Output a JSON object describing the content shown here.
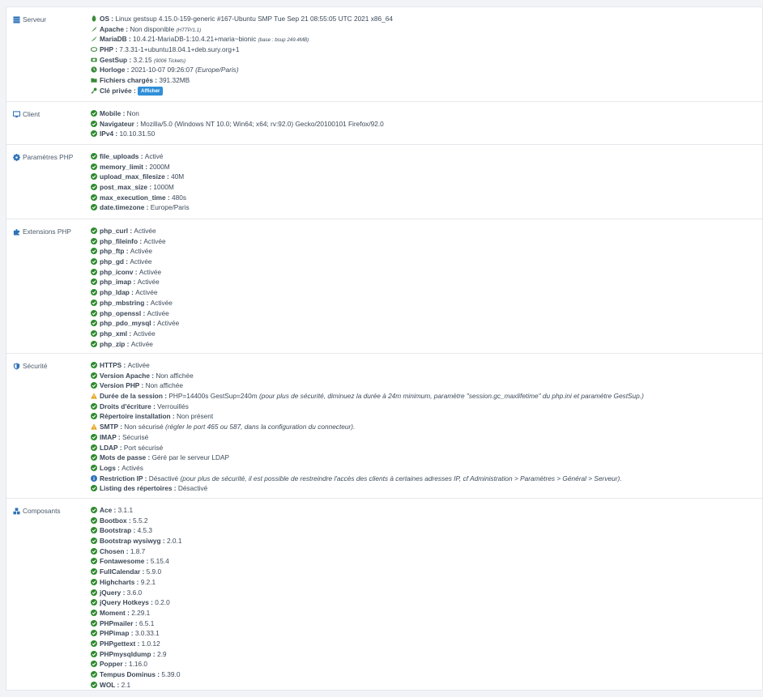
{
  "colors": {
    "ok": "#2e8b2e",
    "warn": "#e7a21b",
    "info": "#2f73b8",
    "icon_green": "#3a8a3a",
    "button": "#2f8fd8"
  },
  "sections": [
    {
      "id": "serveur",
      "label": "Serveur",
      "icon": "server-icon",
      "rows": [
        {
          "icon": "linux-icon",
          "label": "OS",
          "value": "Linux gestsup 4.15.0-159-generic #167-Ubuntu SMP Tue Sep 21 08:55:05 UTC 2021 x86_64",
          "note": ""
        },
        {
          "icon": "feather-icon",
          "label": "Apache",
          "value": "Non disponible",
          "note": "(HTTP/1.1)"
        },
        {
          "icon": "dolphin-icon",
          "label": "MariaDB",
          "value": "10.4.21-MariaDB-1:10.4.21+maria~bionic",
          "note": "(base : bsup 249.4MB)"
        },
        {
          "icon": "php-icon",
          "label": "PHP",
          "value": "7.3.31-1+ubuntu18.04.1+deb.sury.org+1",
          "note": ""
        },
        {
          "icon": "ticket-icon",
          "label": "GestSup",
          "value": "3.2.15",
          "note": "(9006 Tickets)"
        },
        {
          "icon": "clock-icon",
          "label": "Horloge",
          "value": "2021-10-07 09:26:07",
          "note": "(Europe/Paris)"
        },
        {
          "icon": "folder-icon",
          "label": "Fichiers chargés",
          "value": "391.32MB",
          "note": ""
        },
        {
          "icon": "key-icon",
          "label": "Clé privée",
          "value": "",
          "note": "",
          "button": "Afficher"
        }
      ]
    },
    {
      "id": "client",
      "label": "Client",
      "icon": "desktop-icon",
      "rows": [
        {
          "icon": "check-icon",
          "label": "Mobile",
          "value": "Non"
        },
        {
          "icon": "check-icon",
          "label": "Navigateur",
          "value": "Mozilla/5.0 (Windows NT 10.0; Win64; x64; rv:92.0) Gecko/20100101 Firefox/92.0"
        },
        {
          "icon": "check-icon",
          "label": "IPv4",
          "value": "10.10.31.50"
        }
      ]
    },
    {
      "id": "php-params",
      "label": "Paramètres PHP",
      "icon": "gear-icon",
      "rows": [
        {
          "icon": "check-icon",
          "label": "file_uploads",
          "value": "Activé"
        },
        {
          "icon": "check-icon",
          "label": "memory_limit",
          "value": "2000M"
        },
        {
          "icon": "check-icon",
          "label": "upload_max_filesize",
          "value": "40M"
        },
        {
          "icon": "check-icon",
          "label": "post_max_size",
          "value": "1000M"
        },
        {
          "icon": "check-icon",
          "label": "max_execution_time",
          "value": "480s"
        },
        {
          "icon": "check-icon",
          "label": "date.timezone",
          "value": "Europe/Paris"
        }
      ]
    },
    {
      "id": "php-ext",
      "label": "Extensions PHP",
      "icon": "puzzle-icon",
      "rows": [
        {
          "icon": "check-icon",
          "label": "php_curl",
          "value": "Activée"
        },
        {
          "icon": "check-icon",
          "label": "php_fileinfo",
          "value": "Activée"
        },
        {
          "icon": "check-icon",
          "label": "php_ftp",
          "value": "Activée"
        },
        {
          "icon": "check-icon",
          "label": "php_gd",
          "value": "Activée"
        },
        {
          "icon": "check-icon",
          "label": "php_iconv",
          "value": "Activée"
        },
        {
          "icon": "check-icon",
          "label": "php_imap",
          "value": "Activée"
        },
        {
          "icon": "check-icon",
          "label": "php_ldap",
          "value": "Activée"
        },
        {
          "icon": "check-icon",
          "label": "php_mbstring",
          "value": "Activée"
        },
        {
          "icon": "check-icon",
          "label": "php_openssl",
          "value": "Activée"
        },
        {
          "icon": "check-icon",
          "label": "php_pdo_mysql",
          "value": "Activée"
        },
        {
          "icon": "check-icon",
          "label": "php_xml",
          "value": "Activée"
        },
        {
          "icon": "check-icon",
          "label": "php_zip",
          "value": "Activée"
        }
      ]
    },
    {
      "id": "securite",
      "label": "Sécurité",
      "icon": "shield-icon",
      "rows": [
        {
          "icon": "check-icon",
          "label": "HTTPS",
          "value": "Activée",
          "note": ""
        },
        {
          "icon": "check-icon",
          "label": "Version Apache",
          "value": "Non affichée",
          "note": ""
        },
        {
          "icon": "check-icon",
          "label": "Version PHP",
          "value": "Non affichée",
          "note": ""
        },
        {
          "icon": "warning-icon",
          "label": "Durée de la session",
          "value": "PHP=14400s GestSup=240m",
          "note": "(pour plus de sécurité, diminuez la durée à 24m minimum, paramètre \"session.gc_maxlifetime\" du php.ini et paramètre GestSup.)"
        },
        {
          "icon": "check-icon",
          "label": "Droits d'écriture",
          "value": "Verrouillés",
          "note": ""
        },
        {
          "icon": "check-icon",
          "label": "Répertoire installation",
          "value": "Non présent",
          "note": ""
        },
        {
          "icon": "warning-icon",
          "label": "SMTP",
          "value": "Non sécurisé",
          "note": "(régler le port 465 ou 587, dans la configuration du connecteur)."
        },
        {
          "icon": "check-icon",
          "label": "IMAP",
          "value": "Sécurisé",
          "note": ""
        },
        {
          "icon": "check-icon",
          "label": "LDAP",
          "value": "Port sécurisé",
          "note": ""
        },
        {
          "icon": "check-icon",
          "label": "Mots de passe",
          "value": "Géré par le serveur LDAP",
          "note": ""
        },
        {
          "icon": "check-icon",
          "label": "Logs",
          "value": "Activés",
          "note": ""
        },
        {
          "icon": "info-icon",
          "label": "Restriction IP",
          "value": "Désactivé",
          "note": "(pour plus de sécurité, il est possible de restreindre l'accès des clients à certaines adresses IP, cf Administration > Paramètres > Général > Serveur)."
        },
        {
          "icon": "check-icon",
          "label": "Listing des répertoires",
          "value": "Désactivé",
          "note": ""
        }
      ]
    },
    {
      "id": "composants",
      "label": "Composants",
      "icon": "cubes-icon",
      "rows": [
        {
          "icon": "check-icon",
          "label": "Ace",
          "value": "3.1.1"
        },
        {
          "icon": "check-icon",
          "label": "Bootbox",
          "value": "5.5.2"
        },
        {
          "icon": "check-icon",
          "label": "Bootstrap",
          "value": "4.5.3"
        },
        {
          "icon": "check-icon",
          "label": "Bootstrap wysiwyg",
          "value": "2.0.1"
        },
        {
          "icon": "check-icon",
          "label": "Chosen",
          "value": "1.8.7"
        },
        {
          "icon": "check-icon",
          "label": "Fontawesome",
          "value": "5.15.4"
        },
        {
          "icon": "check-icon",
          "label": "FullCalendar",
          "value": "5.9.0"
        },
        {
          "icon": "check-icon",
          "label": "Highcharts",
          "value": "9.2.1"
        },
        {
          "icon": "check-icon",
          "label": "jQuery",
          "value": "3.6.0"
        },
        {
          "icon": "check-icon",
          "label": "jQuery Hotkeys",
          "value": "0.2.0"
        },
        {
          "icon": "check-icon",
          "label": "Moment",
          "value": "2.29.1"
        },
        {
          "icon": "check-icon",
          "label": "PHPmailer",
          "value": "6.5.1"
        },
        {
          "icon": "check-icon",
          "label": "PHPimap",
          "value": "3.0.33.1"
        },
        {
          "icon": "check-icon",
          "label": "PHPgettext",
          "value": "1.0.12"
        },
        {
          "icon": "check-icon",
          "label": "PHPmysqldump",
          "value": "2.9"
        },
        {
          "icon": "check-icon",
          "label": "Popper",
          "value": "1.16.0"
        },
        {
          "icon": "check-icon",
          "label": "Tempus Dominus",
          "value": "5.39.0"
        },
        {
          "icon": "check-icon",
          "label": "WOL",
          "value": "2.1"
        }
      ]
    }
  ]
}
